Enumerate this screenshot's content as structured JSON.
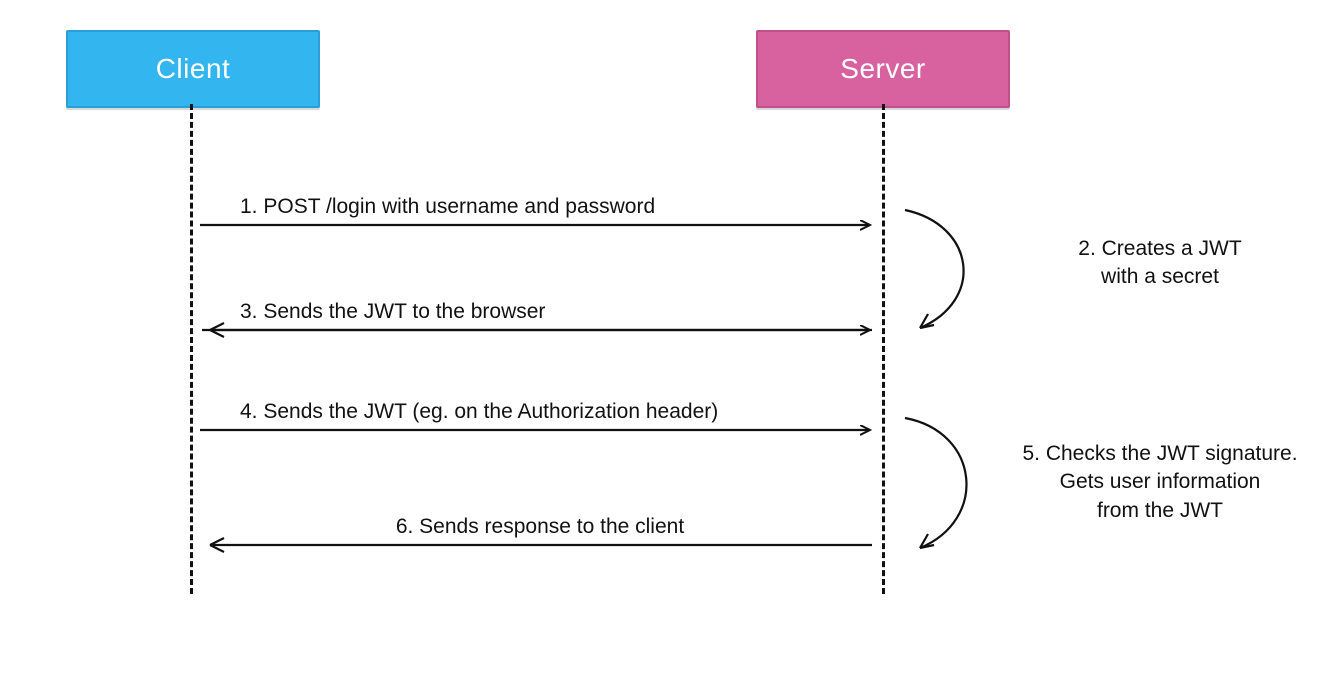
{
  "actors": {
    "client": "Client",
    "server": "Server"
  },
  "messages": {
    "m1": "1. POST /login with username and password",
    "m2a": "2. Creates a JWT",
    "m2b": "with a secret",
    "m3": "3. Sends the JWT to the browser",
    "m4": "4. Sends the JWT (eg. on the Authorization header)",
    "m5a": "5. Checks the JWT signature.",
    "m5b": "Gets user information",
    "m5c": "from the JWT",
    "m6": "6. Sends response to the client"
  },
  "colors": {
    "client": "#33b5ef",
    "server": "#d862a0",
    "line": "#111111"
  }
}
